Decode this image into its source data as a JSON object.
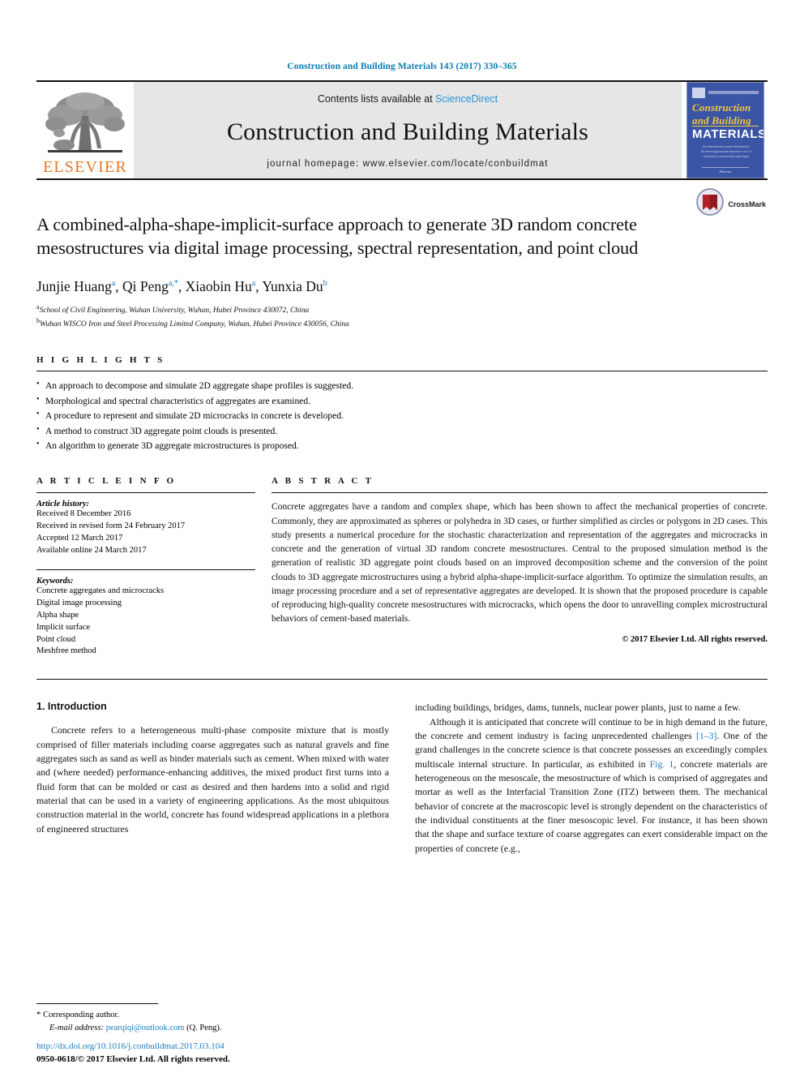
{
  "running_head": "Construction and Building Materials 143 (2017) 330–365",
  "masthead": {
    "publisher_name": "ELSEVIER",
    "contents_prefix": "Contents lists available at ",
    "sciencedirect": "ScienceDirect",
    "journal_title": "Construction and Building Materials",
    "homepage": "journal homepage: www.elsevier.com/locate/conbuildmat",
    "cover": {
      "line1": "Construction",
      "line2": "and Building",
      "line3": "MATERIALS",
      "blurb": "An international journal dedicated to the investigation and innovative use of materials in construction and repair",
      "footer": "Elsevier"
    }
  },
  "crossmark": {
    "label": "CrossMark"
  },
  "title": "A combined-alpha-shape-implicit-surface approach to generate 3D random concrete mesostructures via digital image processing, spectral representation, and point cloud",
  "authors": [
    {
      "name": "Junjie Huang",
      "marks": "a"
    },
    {
      "name": "Qi Peng",
      "marks": "a,*"
    },
    {
      "name": "Xiaobin Hu",
      "marks": "a"
    },
    {
      "name": "Yunxia Du",
      "marks": "b"
    }
  ],
  "affiliations": [
    {
      "mark": "a",
      "text": "School of Civil Engineering, Wuhan University, Wuhan, Hubei Province 430072, China"
    },
    {
      "mark": "b",
      "text": "Wuhan WISCO Iron and Steel Processing Limited Company, Wuhan, Hubei Province 430056, China"
    }
  ],
  "highlights": {
    "heading": "H I G H L I G H T S",
    "items": [
      "An approach to decompose and simulate 2D aggregate shape profiles is suggested.",
      "Morphological and spectral characteristics of aggregates are examined.",
      "A procedure to represent and simulate 2D microcracks in concrete is developed.",
      "A method to construct 3D aggregate point clouds is presented.",
      "An algorithm to generate 3D aggregate microstructures is proposed."
    ]
  },
  "article_info": {
    "heading": "A R T I C L E   I N F O",
    "history_label": "Article history:",
    "history": [
      "Received 8 December 2016",
      "Received in revised form 24 February 2017",
      "Accepted 12 March 2017",
      "Available online 24 March 2017"
    ],
    "keywords_label": "Keywords:",
    "keywords": [
      "Concrete aggregates and microcracks",
      "Digital image processing",
      "Alpha shape",
      "Implicit surface",
      "Point cloud",
      "Meshfree method"
    ]
  },
  "abstract": {
    "heading": "A B S T R A C T",
    "text": "Concrete aggregates have a random and complex shape, which has been shown to affect the mechanical properties of concrete. Commonly, they are approximated as spheres or polyhedra in 3D cases, or further simplified as circles or polygons in 2D cases. This study presents a numerical procedure for the stochastic characterization and representation of the aggregates and microcracks in concrete and the generation of virtual 3D random concrete mesostructures. Central to the proposed simulation method is the generation of realistic 3D aggregate point clouds based on an improved decomposition scheme and the conversion of the point clouds to 3D aggregate microstructures using a hybrid alpha-shape-implicit-surface algorithm. To optimize the simulation results, an image processing procedure and a set of representative aggregates are developed. It is shown that the proposed procedure is capable of reproducing high-quality concrete mesostructures with microcracks, which opens the door to unravelling complex microstructural behaviors of cement-based materials.",
    "copyright": "© 2017 Elsevier Ltd. All rights reserved."
  },
  "body": {
    "section_heading": "1. Introduction",
    "left_paragraph": "Concrete refers to a heterogeneous multi-phase composite mixture that is mostly comprised of filler materials including coarse aggregates such as natural gravels and fine aggregates such as sand as well as binder materials such as cement. When mixed with water and (where needed) performance-enhancing additives, the mixed product first turns into a fluid form that can be molded or cast as desired and then hardens into a solid and rigid material that can be used in a variety of engineering applications. As the most ubiquitous construction material in the world, concrete has found widespread applications in a plethora of engineered structures",
    "right_paragraph_1": "including buildings, bridges, dams, tunnels, nuclear power plants, just to name a few.",
    "right_paragraph_2a": "Although it is anticipated that concrete will continue to be in high demand in the future, the concrete and cement industry is facing unprecedented challenges ",
    "right_ref_1": "[1–3]",
    "right_paragraph_2b": ". One of the grand challenges in the concrete science is that concrete possesses an exceedingly complex multiscale internal structure. In particular, as exhibited in ",
    "right_ref_2": "Fig. 1",
    "right_paragraph_2c": ", concrete materials are heterogeneous on the mesoscale, the mesostructure of which is comprised of aggregates and mortar as well as the Interfacial Transition Zone (ITZ) between them. The mechanical behavior of concrete at the macroscopic level is strongly dependent on the characteristics of the individual constituents at the finer mesoscopic level. For instance, it has been shown that the shape and surface texture of coarse aggregates can exert considerable impact on the properties of concrete (e.g.,"
  },
  "footnote": {
    "corresponding_mark": "*",
    "corresponding_text": "Corresponding author.",
    "email_label": "E-mail address:",
    "email": "pearqiqi@outlook.com",
    "email_suffix": "(Q. Peng).",
    "doi": "http://dx.doi.org/10.1016/j.conbuildmat.2017.03.104",
    "issn": "0950-0618/© 2017 Elsevier Ltd. All rights reserved."
  },
  "colors": {
    "link_blue": "#1c7bbd",
    "sciencedirect_blue": "#2b93d1",
    "elsevier_orange": "#e87722",
    "masthead_gray": "#e6e6e6",
    "cover_blue": "#3b55a6"
  }
}
